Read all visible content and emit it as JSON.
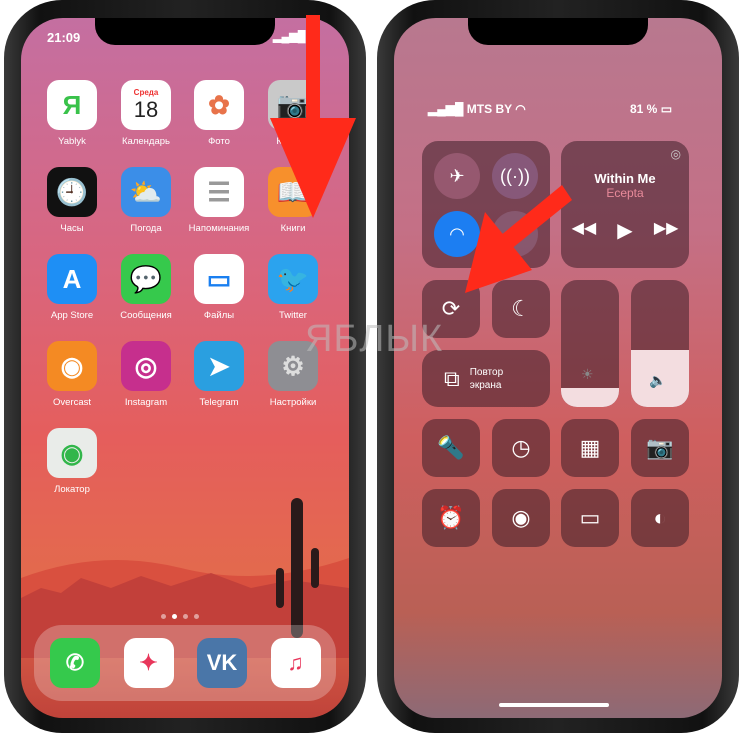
{
  "home": {
    "time": "21:09",
    "apps": [
      {
        "label": "Yablyk",
        "glyph": "Я",
        "bg": "#ffffff",
        "fg": "#39c24a"
      },
      {
        "label": "Календарь",
        "glyph": "18",
        "day": "Среда",
        "bg": "#ffffff",
        "fg": "#222"
      },
      {
        "label": "Фото",
        "glyph": "✿",
        "bg": "#ffffff",
        "fg": "#e8734a"
      },
      {
        "label": "Камера",
        "glyph": "📷",
        "bg": "#c9c9c9",
        "fg": "#333"
      },
      {
        "label": "Часы",
        "glyph": "🕘",
        "bg": "#111111",
        "fg": "#fff"
      },
      {
        "label": "Погода",
        "glyph": "⛅",
        "bg": "#3b8ee8",
        "fg": "#fff"
      },
      {
        "label": "Напоминания",
        "glyph": "☰",
        "bg": "#ffffff",
        "fg": "#999"
      },
      {
        "label": "Книги",
        "glyph": "📖",
        "bg": "#f7902c",
        "fg": "#fff"
      },
      {
        "label": "App Store",
        "glyph": "A",
        "bg": "#1e8ff5",
        "fg": "#fff"
      },
      {
        "label": "Сообщения",
        "glyph": "💬",
        "bg": "#36c94c",
        "fg": "#fff"
      },
      {
        "label": "Файлы",
        "glyph": "▭",
        "bg": "#ffffff",
        "fg": "#1a7ff0"
      },
      {
        "label": "Twitter",
        "glyph": "🐦",
        "bg": "#2ba3ee",
        "fg": "#fff"
      },
      {
        "label": "Overcast",
        "glyph": "◉",
        "bg": "#f48a23",
        "fg": "#fff"
      },
      {
        "label": "Instagram",
        "glyph": "◎",
        "bg": "#c62f8d",
        "fg": "#fff"
      },
      {
        "label": "Telegram",
        "glyph": "➤",
        "bg": "#2a9fe0",
        "fg": "#fff"
      },
      {
        "label": "Настройки",
        "glyph": "⚙",
        "bg": "#8e8e93",
        "fg": "#ddd"
      },
      {
        "label": "Локатор",
        "glyph": "◉",
        "bg": "#e9ece9",
        "fg": "#31b64a"
      }
    ],
    "dock": [
      {
        "name": "phone",
        "glyph": "✆",
        "bg": "#35c94c"
      },
      {
        "name": "safari",
        "glyph": "✦",
        "bg": "#ffffff"
      },
      {
        "name": "vk",
        "glyph": "VK",
        "bg": "#4a76a8"
      },
      {
        "name": "music",
        "glyph": "♫",
        "bg": "#ffffff"
      }
    ],
    "page_count": 4,
    "current_page": 2
  },
  "control_center": {
    "carrier": "MTS BY",
    "battery": "81 %",
    "media": {
      "title": "Within Me",
      "artist": "Ecepta"
    },
    "screen_mirroring": [
      "Повтор",
      "экрана"
    ],
    "brightness_percent": 15,
    "volume_percent": 45,
    "wifi_on": true
  },
  "watermark": "ЯБЛЫК",
  "accent": "#ff2a1a"
}
